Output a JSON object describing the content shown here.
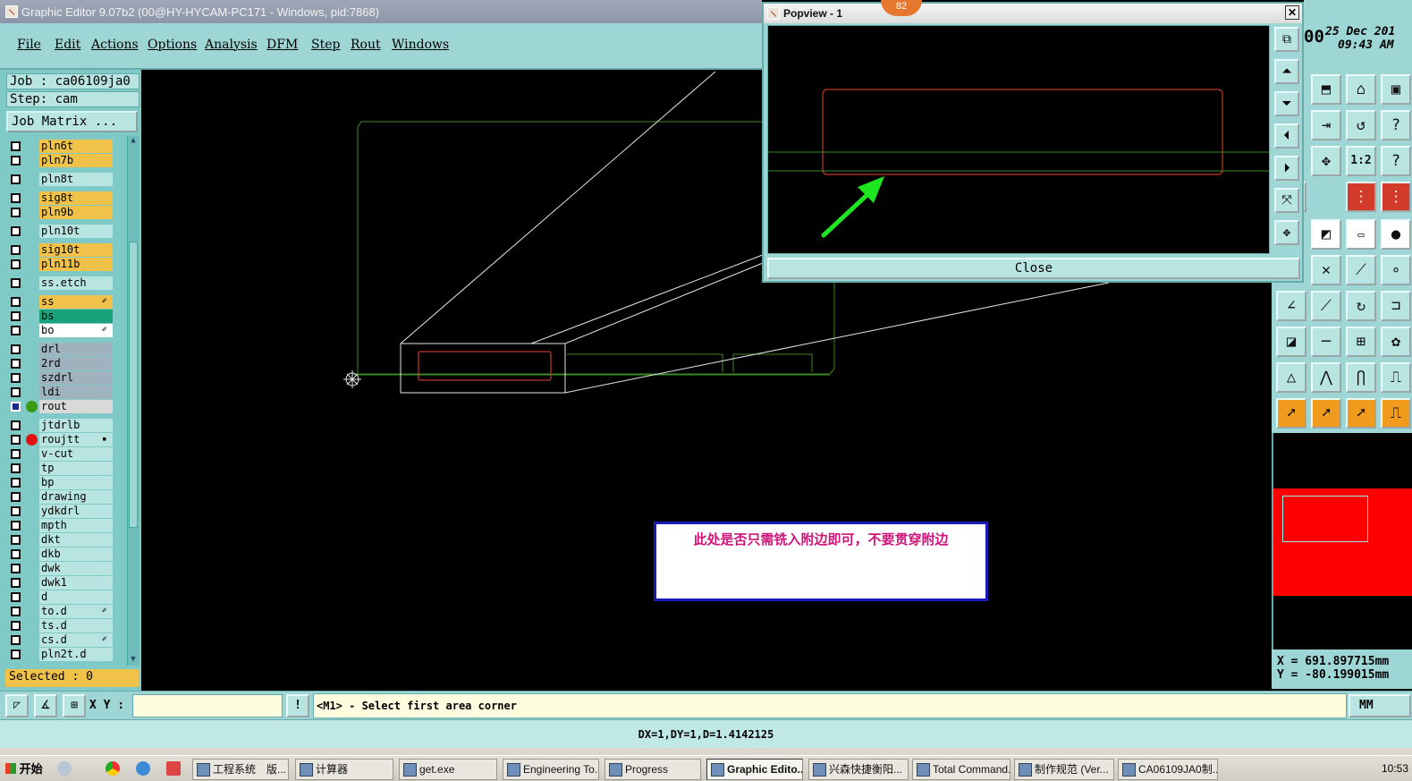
{
  "app": {
    "title": "Graphic Editor 9.07b2 (00@HY-HYCAM-PC171 - Windows, pid:7868)"
  },
  "menu": [
    "File",
    "Edit",
    "Actions",
    "Options",
    "Analysis",
    "DFM",
    "Step",
    "Rout",
    "Windows"
  ],
  "job": {
    "job_label": "Job : ca06109ja0",
    "step_label": "Step: cam",
    "matrix_button": "Job Matrix ..."
  },
  "layers": [
    {
      "name": "pln6t",
      "color": "#f0c24a",
      "dot": "",
      "mark": ""
    },
    {
      "name": "pln7b",
      "color": "#f0c24a",
      "dot": "",
      "mark": ""
    },
    {
      "name": "pln8t",
      "color": "#b8e4e2",
      "dot": "",
      "mark": ""
    },
    {
      "name": "sig8t",
      "color": "#f0c24a",
      "dot": "",
      "mark": ""
    },
    {
      "name": "pln9b",
      "color": "#f0c24a",
      "dot": "",
      "mark": ""
    },
    {
      "name": "pln10t",
      "color": "#b8e4e2",
      "dot": "",
      "mark": ""
    },
    {
      "name": "sig10t",
      "color": "#f0c24a",
      "dot": "",
      "mark": ""
    },
    {
      "name": "pln11b",
      "color": "#f0c24a",
      "dot": "",
      "mark": ""
    },
    {
      "name": "ss.etch",
      "color": "#b8e4e2",
      "dot": "",
      "mark": ""
    },
    {
      "name": "ss",
      "color": "#f0c24a",
      "dot": "",
      "mark": "✐"
    },
    {
      "name": "bs",
      "color": "#1aa37a",
      "dot": "",
      "mark": ""
    },
    {
      "name": "bo",
      "color": "#ffffff",
      "dot": "",
      "mark": "✐"
    },
    {
      "name": "drl",
      "color": "#9fb3bf",
      "dot": "",
      "mark": ""
    },
    {
      "name": "2rd",
      "color": "#9fb3bf",
      "dot": "",
      "mark": ""
    },
    {
      "name": "szdrl",
      "color": "#9fb3bf",
      "dot": "",
      "mark": ""
    },
    {
      "name": "ldi",
      "color": "#9fb3bf",
      "dot": "",
      "mark": ""
    },
    {
      "name": "rout",
      "color": "#d9d9d9",
      "dot": "#3a9a12",
      "mark": ""
    },
    {
      "name": "jtdrlb",
      "color": "#b8e4e2",
      "dot": "",
      "mark": ""
    },
    {
      "name": "roujtt",
      "color": "#b8e4e2",
      "dot": "#e31212",
      "mark": "▪"
    },
    {
      "name": "v-cut",
      "color": "#b8e4e2",
      "dot": "",
      "mark": ""
    },
    {
      "name": "tp",
      "color": "#b8e4e2",
      "dot": "",
      "mark": ""
    },
    {
      "name": "bp",
      "color": "#b8e4e2",
      "dot": "",
      "mark": ""
    },
    {
      "name": "drawing",
      "color": "#b8e4e2",
      "dot": "",
      "mark": ""
    },
    {
      "name": "ydkdrl",
      "color": "#b8e4e2",
      "dot": "",
      "mark": ""
    },
    {
      "name": "mpth",
      "color": "#b8e4e2",
      "dot": "",
      "mark": ""
    },
    {
      "name": "dkt",
      "color": "#b8e4e2",
      "dot": "",
      "mark": ""
    },
    {
      "name": "dkb",
      "color": "#b8e4e2",
      "dot": "",
      "mark": ""
    },
    {
      "name": "dwk",
      "color": "#b8e4e2",
      "dot": "",
      "mark": ""
    },
    {
      "name": "dwk1",
      "color": "#b8e4e2",
      "dot": "",
      "mark": ""
    },
    {
      "name": "d",
      "color": "#b8e4e2",
      "dot": "",
      "mark": ""
    },
    {
      "name": "to.d",
      "color": "#b8e4e2",
      "dot": "",
      "mark": "✐"
    },
    {
      "name": "ts.d",
      "color": "#b8e4e2",
      "dot": "",
      "mark": ""
    },
    {
      "name": "cs.d",
      "color": "#b8e4e2",
      "dot": "",
      "mark": "✐"
    },
    {
      "name": "pln2t.d",
      "color": "#b8e4e2",
      "dot": "",
      "mark": ""
    }
  ],
  "selected": "Selected : 0",
  "annotation": "此处是否只需铣入附边即可，不要贯穿附边",
  "popview": {
    "title": "Popview - 1",
    "close_label": "Close",
    "badge": "82"
  },
  "clock": {
    "date": "25 Dec 201",
    "time": "09:43 AM",
    "prefix": "00"
  },
  "coords": {
    "x": "X =  691.897715mm",
    "y": "Y =  -80.199015mm"
  },
  "bottom": {
    "xy_label": "X Y :",
    "xy_value": "",
    "message": "<M1> - Select first area corner",
    "units": "MM",
    "status": "DX=1,DY=1,D=1.4142125"
  },
  "taskbar": {
    "start": "开始",
    "tasks": [
      "工程系统　版...",
      "计算器",
      "get.exe",
      "Engineering To...",
      "Progress",
      "Graphic Edito...",
      "兴森快捷衡阳...",
      "Total Command...",
      "制作规范 (Ver...",
      "CA06109JA0制..."
    ],
    "active_index": 5,
    "time": "10:53"
  },
  "colors": {
    "panel": "#9ed6d6",
    "highlight": "#f0c24a",
    "annotation_text": "#d0157a",
    "annotation_border": "#1a1ab8"
  }
}
